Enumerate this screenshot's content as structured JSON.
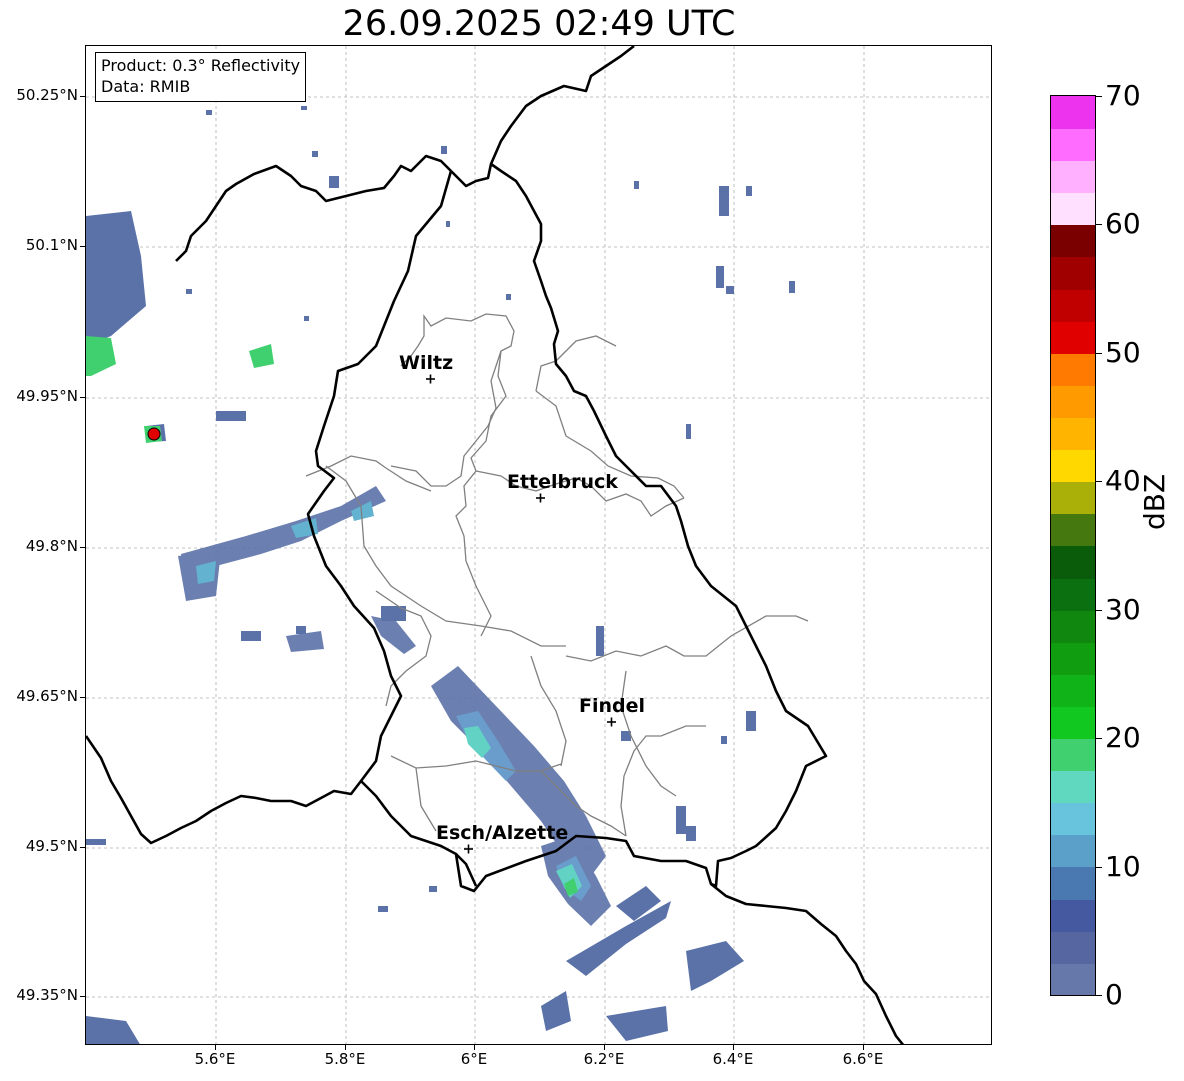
{
  "title": "26.09.2025 02:49 UTC",
  "info": {
    "product": "Product: 0.3° Reflectivity",
    "data_source": "Data: RMIB"
  },
  "axes": {
    "lat_labels": [
      "50.25°N",
      "50.1°N",
      "49.95°N",
      "49.8°N",
      "49.65°N",
      "49.5°N",
      "49.35°N"
    ],
    "lon_labels": [
      "5.6°E",
      "5.8°E",
      "6°E",
      "6.2°E",
      "6.4°E",
      "6.6°E"
    ]
  },
  "cities": [
    {
      "name": "Wiltz"
    },
    {
      "name": "Ettelbruck"
    },
    {
      "name": "Findel"
    },
    {
      "name": "Esch/Alzette"
    }
  ],
  "colorbar": {
    "unit": "dBZ",
    "tick_labels": [
      "0",
      "10",
      "20",
      "30",
      "40",
      "50",
      "60",
      "70"
    ],
    "min": 0,
    "max": 70,
    "step": 2.5,
    "colors": [
      "#6677aa",
      "#5566a0",
      "#4459a0",
      "#4a78b0",
      "#5aa0c8",
      "#68c4dc",
      "#60d8c0",
      "#40d070",
      "#10c820",
      "#10b418",
      "#109e10",
      "#108810",
      "#0a7010",
      "#0a5c0a",
      "#467810",
      "#aab008",
      "#ffd800",
      "#ffb400",
      "#ff9a00",
      "#ff7a00",
      "#e00000",
      "#c00000",
      "#a00000",
      "#7a0000",
      "#ffe0ff",
      "#ffb0ff",
      "#ff6cff",
      "#ee33ee"
    ]
  },
  "colors": {
    "border_country": "#000000",
    "border_canton": "#808080",
    "grid": "#b0b0b0",
    "radar_marker": "#e00000"
  }
}
